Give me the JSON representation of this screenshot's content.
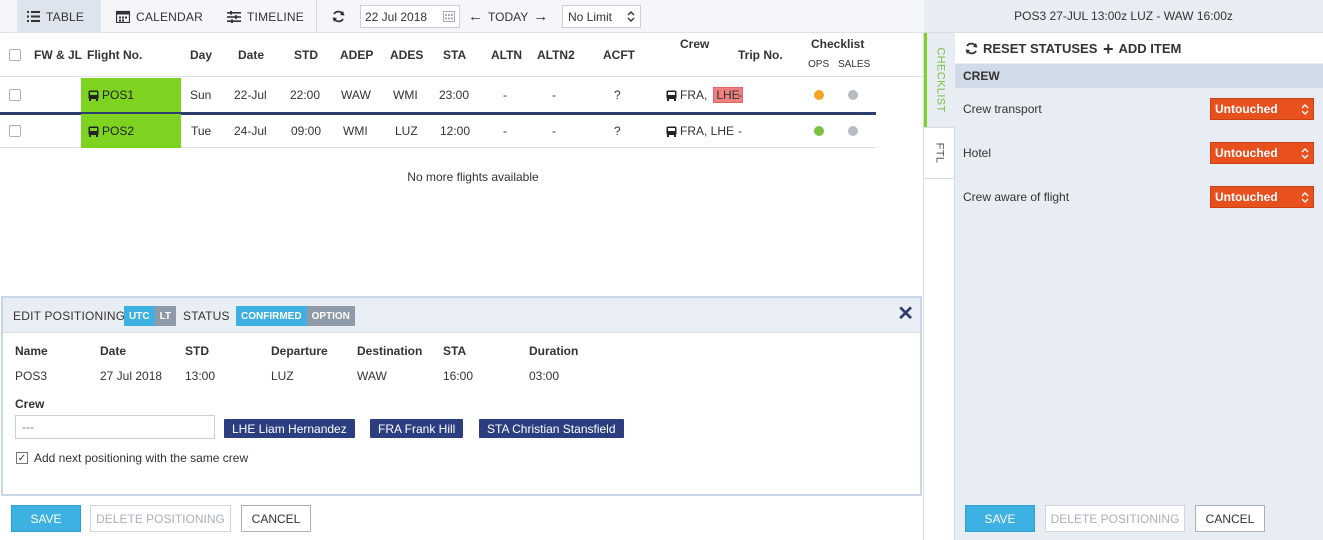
{
  "toolbar": {
    "views": [
      {
        "label": "TABLE",
        "icon": "list-icon",
        "active": true
      },
      {
        "label": "CALENDAR",
        "icon": "calendar-icon",
        "active": false
      },
      {
        "label": "TIMELINE",
        "icon": "sliders-icon",
        "active": false
      }
    ],
    "date_value": "22 Jul 2018",
    "today_label": "TODAY",
    "limit_value": "No Limit"
  },
  "table": {
    "headers": {
      "fw_jl": "FW & JL",
      "flight_no": "Flight No.",
      "day": "Day",
      "date": "Date",
      "std": "STD",
      "adep": "ADEP",
      "ades": "ADES",
      "sta": "STA",
      "altn": "ALTN",
      "altn2": "ALTN2",
      "acft": "ACFT",
      "crew": "Crew",
      "trip_no": "Trip No.",
      "checklist": "Checklist",
      "ops": "OPS",
      "sales": "SALES"
    },
    "rows": [
      {
        "flight": "POS1",
        "day": "Sun",
        "date": "22-Jul",
        "std": "22:00",
        "adep": "WAW",
        "ades": "WMI",
        "sta": "23:00",
        "altn": "-",
        "altn2": "-",
        "acft": "?",
        "crew_a": "FRA,",
        "crew_b": "LHE",
        "trip": "-",
        "ops_color": "#f5a623",
        "sales_color": "#b7bcc2"
      },
      {
        "flight": "POS2",
        "day": "Tue",
        "date": "24-Jul",
        "std": "09:00",
        "adep": "WMI",
        "ades": "LUZ",
        "sta": "12:00",
        "altn": "-",
        "altn2": "-",
        "acft": "?",
        "crew_a": "FRA, LHE",
        "crew_b": "",
        "trip": "-",
        "ops_color": "#7ac142",
        "sales_color": "#b7bcc2"
      }
    ],
    "no_more": "No more flights available"
  },
  "edit": {
    "title": "EDIT POSITIONING",
    "utc": "UTC",
    "lt": "LT",
    "status_label": "STATUS",
    "confirmed": "CONFIRMED",
    "option": "OPTION",
    "cols": {
      "name": "Name",
      "date": "Date",
      "std": "STD",
      "departure": "Departure",
      "destination": "Destination",
      "sta": "STA",
      "duration": "Duration"
    },
    "values": {
      "name": "POS3",
      "date": "27 Jul 2018",
      "std": "13:00",
      "departure": "LUZ",
      "destination": "WAW",
      "sta": "16:00",
      "duration": "03:00"
    },
    "crew_label": "Crew",
    "crew_input": "---",
    "crew_chips": [
      "LHE Liam Hernandez",
      "FRA Frank Hill",
      "STA Christian Stansfield"
    ],
    "same_crew_label": "Add next positioning with the same crew"
  },
  "buttons": {
    "save": "SAVE",
    "delete": "DELETE POSITIONING",
    "cancel": "CANCEL"
  },
  "right": {
    "title": "POS3 27-JUL 13:00z LUZ - WAW 16:00z",
    "tab_checklist": "CHECKLIST",
    "tab_ftl": "FTL",
    "reset_label": "RESET STATUSES",
    "add_label": "ADD ITEM",
    "section": "CREW",
    "items": [
      {
        "label": "Crew transport",
        "status": "Untouched"
      },
      {
        "label": "Hotel",
        "status": "Untouched"
      },
      {
        "label": "Crew aware of flight",
        "status": "Untouched"
      }
    ]
  },
  "colors": {
    "accent": "#3db1e1",
    "flight_green": "#7ed321",
    "untouched": "#e8501d",
    "chip": "#2c3e80",
    "checklist_tab": "#7ed321"
  }
}
